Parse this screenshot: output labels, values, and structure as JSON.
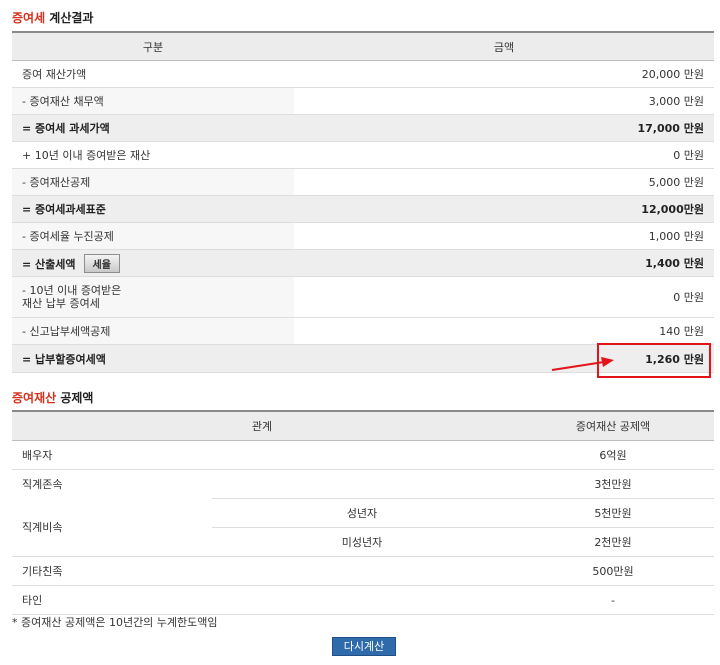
{
  "result": {
    "title_red": "증여세",
    "title_rest": " 계산결과",
    "headers": {
      "category": "구분",
      "amount": "금액"
    },
    "rows": [
      {
        "label": "증여 재산가액",
        "value": "20,000 만원"
      },
      {
        "label": "- 증여재산 채무액",
        "value": "3,000 만원"
      },
      {
        "label": "= 증여세 과세가액",
        "value": "17,000 만원"
      },
      {
        "label": "+ 10년 이내 증여받은 재산",
        "value": "0 만원"
      },
      {
        "label": "- 증여재산공제",
        "value": "5,000 만원"
      },
      {
        "label": "= 증여세과세표준",
        "value": "12,000만원"
      },
      {
        "label": "- 증여세율 누진공제",
        "value": "1,000 만원"
      },
      {
        "label": "= 산출세액",
        "value": "1,400 만원"
      },
      {
        "label_line1": "- 10년 이내 증여받은",
        "label_line2": "재산 납부 증여세",
        "value": "0 만원"
      },
      {
        "label": "- 신고납부세액공제",
        "value": "140 만원"
      },
      {
        "label": "= 납부할증여세액",
        "value": "1,260 만원"
      }
    ],
    "tax_rate_button": "세율"
  },
  "deduction": {
    "title_red": "증여재산",
    "title_rest": " 공제액",
    "headers": {
      "relation": "관계",
      "amount": "증여재산 공제액"
    },
    "rows": [
      {
        "relation": "배우자",
        "sub": "",
        "amount": "6억원"
      },
      {
        "relation": "직계존속",
        "sub": "",
        "amount": "3천만원"
      },
      {
        "relation": "직계비속",
        "sub": "성년자",
        "amount": "5천만원"
      },
      {
        "relation": "",
        "sub": "미성년자",
        "amount": "2천만원"
      },
      {
        "relation": "기타친족",
        "sub": "",
        "amount": "500만원"
      },
      {
        "relation": "타인",
        "sub": "",
        "amount": "-"
      }
    ]
  },
  "note": "* 증여재산 공제액은 10년간의 누계한도액임",
  "recalc_button": "다시계산",
  "colors": {
    "accent_red": "#d8301c",
    "highlight_red": "#e2141a",
    "button_blue": "#2f6bab"
  }
}
